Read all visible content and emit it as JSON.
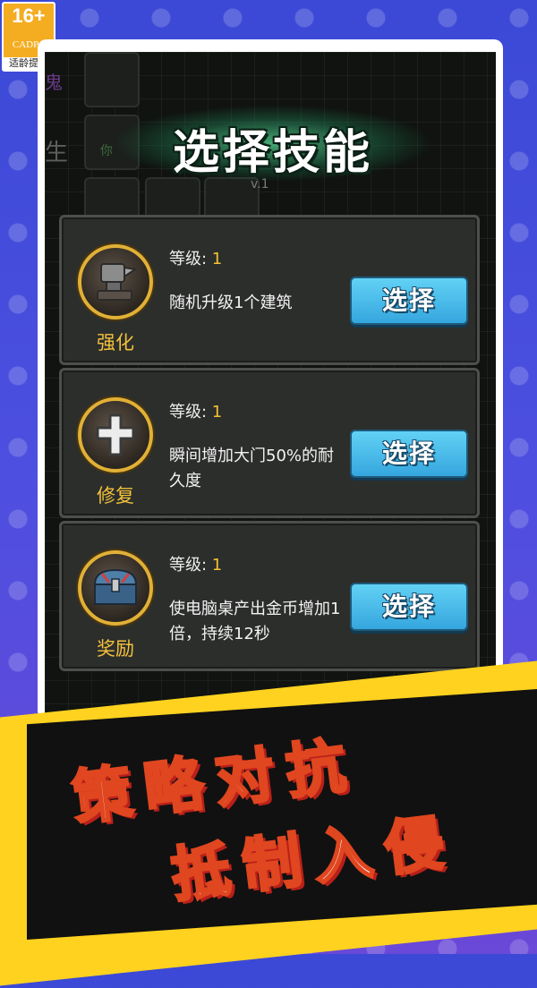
{
  "age_rating": {
    "label": "16+",
    "org": "CADPA",
    "tip": "适龄提示"
  },
  "background_hint": {
    "left_char_1": "鬼",
    "left_char_2": "生",
    "tile_label": "你",
    "version": "v.1"
  },
  "dialog": {
    "title": "选择技能",
    "level_prefix": "等级: ",
    "options": [
      {
        "name": "强化",
        "level": "1",
        "description": "随机升级1个建筑",
        "button": "选择",
        "icon": "anvil-icon"
      },
      {
        "name": "修复",
        "level": "1",
        "description": "瞬间增加大门50%的耐久度",
        "button": "选择",
        "icon": "cross-icon"
      },
      {
        "name": "奖励",
        "level": "1",
        "description": "使电脑桌产出金币增加1倍，持续12秒",
        "button": "选择",
        "icon": "treasure-chest-icon"
      }
    ]
  },
  "slogan": {
    "line1": "策略对抗",
    "line2": "抵制入侵"
  },
  "colors": {
    "button": "#35a6de",
    "gold": "#f2c232",
    "panel": "#2c2e2c",
    "slogan_stroke": "#e0461f"
  }
}
